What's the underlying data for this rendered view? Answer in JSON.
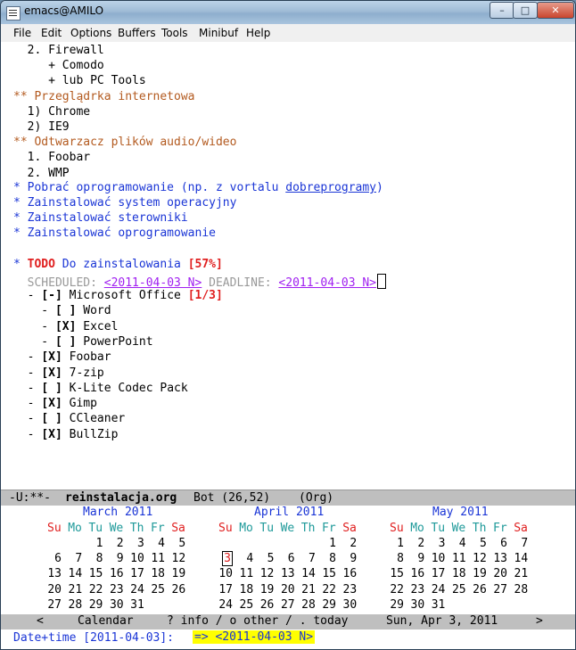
{
  "window": {
    "title": "emacs@AMILO",
    "min": "–",
    "max": "□",
    "close": "✕"
  },
  "menu": [
    "File",
    "Edit",
    "Options",
    "Buffers",
    "Tools",
    "Minibuf",
    "Help"
  ],
  "editor": {
    "lines": [
      {
        "t": "  2. Firewall"
      },
      {
        "t": "     + Comodo"
      },
      {
        "t": "     + lub PC Tools"
      },
      {
        "t": "** Przeglądrka internetowa",
        "c": "star-orange"
      },
      {
        "t": "  1) Chrome"
      },
      {
        "t": "  2) IE9"
      },
      {
        "t": "** Odtwarzacz plików audio/wideo",
        "c": "star-orange"
      },
      {
        "t": "  1. Foobar"
      },
      {
        "t": "  2. WMP"
      }
    ],
    "pobrac_pre": "* Pobrać oprogramowanie (np. z vortalu ",
    "pobrac_link": "dobreprogramy",
    "pobrac_post": ")",
    "blue2": "* Zainstalować system operacyjny",
    "blue3": "* Zainstalować sterowniki",
    "blue4": "* Zainstalować oprogramowanie",
    "todo_star": "* ",
    "todo_kw": "TODO",
    "todo_text": " Do zainstalowania ",
    "todo_pct": "[57%]",
    "sched_label": "  SCHEDULED: ",
    "sched_date": "<2011-04-03 N>",
    "deadline_label": " DEADLINE: ",
    "deadline_date": "<2011-04-03 N>",
    "items": [
      {
        "pre": "  - ",
        "box": "[-]",
        "text": " Microsoft Office ",
        "extra": "[1/3]"
      },
      {
        "pre": "    - ",
        "box": "[ ]",
        "text": " Word"
      },
      {
        "pre": "    - ",
        "box": "[X]",
        "text": " Excel"
      },
      {
        "pre": "    - ",
        "box": "[ ]",
        "text": " PowerPoint"
      },
      {
        "pre": "  - ",
        "box": "[X]",
        "text": " Foobar"
      },
      {
        "pre": "  - ",
        "box": "[X]",
        "text": " 7-zip"
      },
      {
        "pre": "  - ",
        "box": "[ ]",
        "text": " K-Lite Codec Pack"
      },
      {
        "pre": "  - ",
        "box": "[X]",
        "text": " Gimp"
      },
      {
        "pre": "  - ",
        "box": "[ ]",
        "text": " CCleaner"
      },
      {
        "pre": "  - ",
        "box": "[X]",
        "text": " BullZip"
      }
    ]
  },
  "modeline": {
    "state": "-U:**-",
    "buffer": "reinstalacja.org",
    "pos": "Bot (26,52)",
    "mode": "(Org)"
  },
  "calendar": {
    "weekdays": [
      "Su",
      "Mo",
      "Tu",
      "We",
      "Th",
      "Fr",
      "Sa"
    ],
    "months": [
      {
        "name": "March 2011",
        "start": 2,
        "days": 31
      },
      {
        "name": "April 2011",
        "start": 5,
        "days": 30,
        "selected": 3
      },
      {
        "name": "May 2011",
        "start": 0,
        "days": 31
      }
    ]
  },
  "calstatus": {
    "left": "<",
    "name": "Calendar",
    "help": "? info / o other / . today",
    "date": "Sun, Apr 3, 2011",
    "right": ">"
  },
  "minibuffer": {
    "prompt": "Date+time [2011-04-03]:",
    "value": "=> <2011-04-03 N>"
  },
  "colors": {
    "blue": "#1a35d6",
    "orange": "#b35a1f",
    "red": "#e02020",
    "purple": "#a020f0",
    "weekend": "#e02020",
    "weekday": "#1f9a9a"
  }
}
